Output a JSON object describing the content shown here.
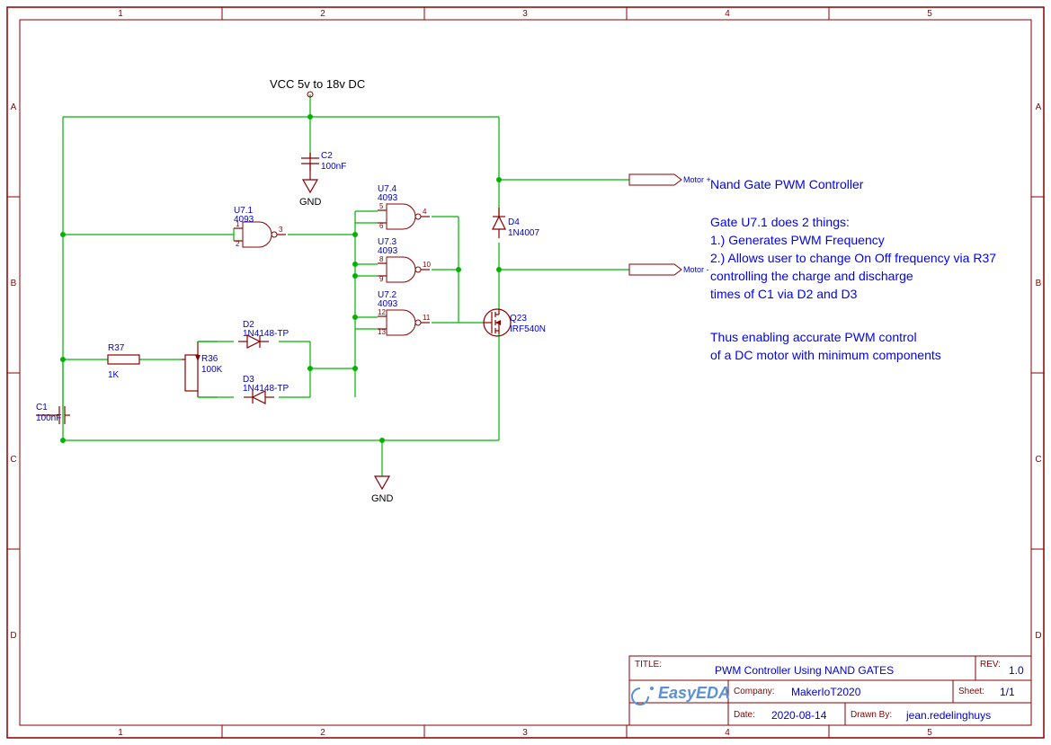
{
  "vcc_label": "VCC 5v to 18v DC",
  "gnd_label": "GND",
  "ports": {
    "motor_plus": "Motor +",
    "motor_minus": "Motor -"
  },
  "components": {
    "C2": {
      "ref": "C2",
      "val": "100nF"
    },
    "C1": {
      "ref": "C1",
      "val": "100nF"
    },
    "U71": {
      "ref": "U7.1",
      "val": "4093",
      "pins": [
        "1",
        "2",
        "3"
      ]
    },
    "U74": {
      "ref": "U7.4",
      "val": "4093",
      "pins": [
        "5",
        "6",
        "4"
      ]
    },
    "U73": {
      "ref": "U7.3",
      "val": "4093",
      "pins": [
        "8",
        "9",
        "10"
      ]
    },
    "U72": {
      "ref": "U7.2",
      "val": "4093",
      "pins": [
        "12",
        "13",
        "11"
      ]
    },
    "R37": {
      "ref": "R37",
      "val": "1K"
    },
    "R36": {
      "ref": "R36",
      "val": "100K"
    },
    "D2": {
      "ref": "D2",
      "val": "1N4148-TP"
    },
    "D3": {
      "ref": "D3",
      "val": "1N4148-TP"
    },
    "D4": {
      "ref": "D4",
      "val": "1N4007"
    },
    "Q23": {
      "ref": "Q23",
      "val": "IRF540N"
    }
  },
  "notes": {
    "heading": "Nand Gate PWM Controller",
    "l1": "Gate U7.1 does 2 things:",
    "l2": "1.) Generates PWM Frequency",
    "l3": "2.) Allows user to change On Off frequency via R37",
    "l4": "controlling the charge and discharge",
    "l5": "times of C1 via D2 and D3",
    "l6": "Thus enabling accurate PWM control",
    "l7": "of a DC motor with minimum components"
  },
  "titleblock": {
    "title_label": "TITLE:",
    "title": "PWM Controller Using NAND GATES",
    "rev_label": "REV:",
    "rev": "1.0",
    "company_label": "Company:",
    "company": "MakerIoT2020",
    "sheet_label": "Sheet:",
    "sheet": "1/1",
    "date_label": "Date:",
    "date": "2020-08-14",
    "drawn_label": "Drawn By:",
    "drawn": "jean.redelinghuys",
    "logo": "EasyEDA"
  },
  "ruler": {
    "cols": [
      "1",
      "2",
      "3",
      "4",
      "5"
    ],
    "rows": [
      "A",
      "B",
      "C",
      "D"
    ]
  }
}
